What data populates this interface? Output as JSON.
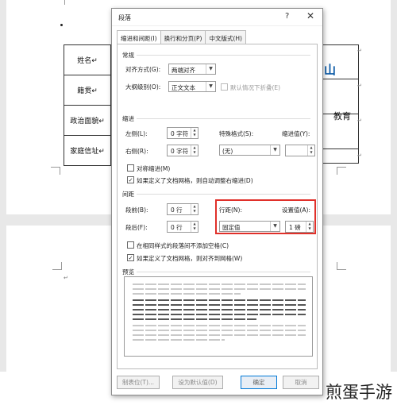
{
  "document": {
    "table_labels": [
      "姓名↵",
      "籍贯↵",
      "政治面貌↵",
      "家庭信址↵"
    ],
    "blue_text": "山",
    "edu_text": "教育",
    "para_mark": "↵"
  },
  "dialog": {
    "title": "段落",
    "help_glyph": "?",
    "close_glyph": "✕",
    "tabs": [
      {
        "label": "缩进和间距(I)",
        "active": true
      },
      {
        "label": "换行和分页(P)",
        "active": false
      },
      {
        "label": "中文版式(H)",
        "active": false
      }
    ],
    "general": {
      "section_label": "常规",
      "alignment_label": "对齐方式(G):",
      "alignment_value": "两端对齐",
      "outline_label": "大纲级别(O):",
      "outline_value": "正文文本",
      "collapsed_label": "默认情况下折叠(E)",
      "collapsed_checked": false
    },
    "indent": {
      "section_label": "缩进",
      "left_label": "左侧(L):",
      "left_value": "0 字符",
      "right_label": "右侧(R):",
      "right_value": "0 字符",
      "special_label": "特殊格式(S):",
      "special_value": "(无)",
      "by_label": "缩进值(Y):",
      "by_value": "",
      "mirror_label": "对称缩进(M)",
      "mirror_checked": false,
      "auto_adjust_label": "如果定义了文档网格，则自动调整右缩进(D)",
      "auto_adjust_checked": true
    },
    "spacing": {
      "section_label": "间距",
      "before_label": "段前(B):",
      "before_value": "0 行",
      "after_label": "段后(F):",
      "after_value": "0 行",
      "line_spacing_label": "行距(N):",
      "line_spacing_value": "固定值",
      "at_label": "设置值(A):",
      "at_value": "1 磅",
      "no_space_label": "在相同样式的段落间不添加空格(C)",
      "no_space_checked": false,
      "snap_grid_label": "如果定义了文档网格，则对齐到网格(W)",
      "snap_grid_checked": true
    },
    "preview": {
      "section_label": "预览"
    },
    "buttons": {
      "tabs": "制表位(T)...",
      "set_default": "设为默认值(D)",
      "ok": "确定",
      "cancel": "取消"
    }
  },
  "watermark": "煎蛋手游",
  "colors": {
    "highlight_border": "#e0302a",
    "link_blue": "#0b5aa6"
  }
}
